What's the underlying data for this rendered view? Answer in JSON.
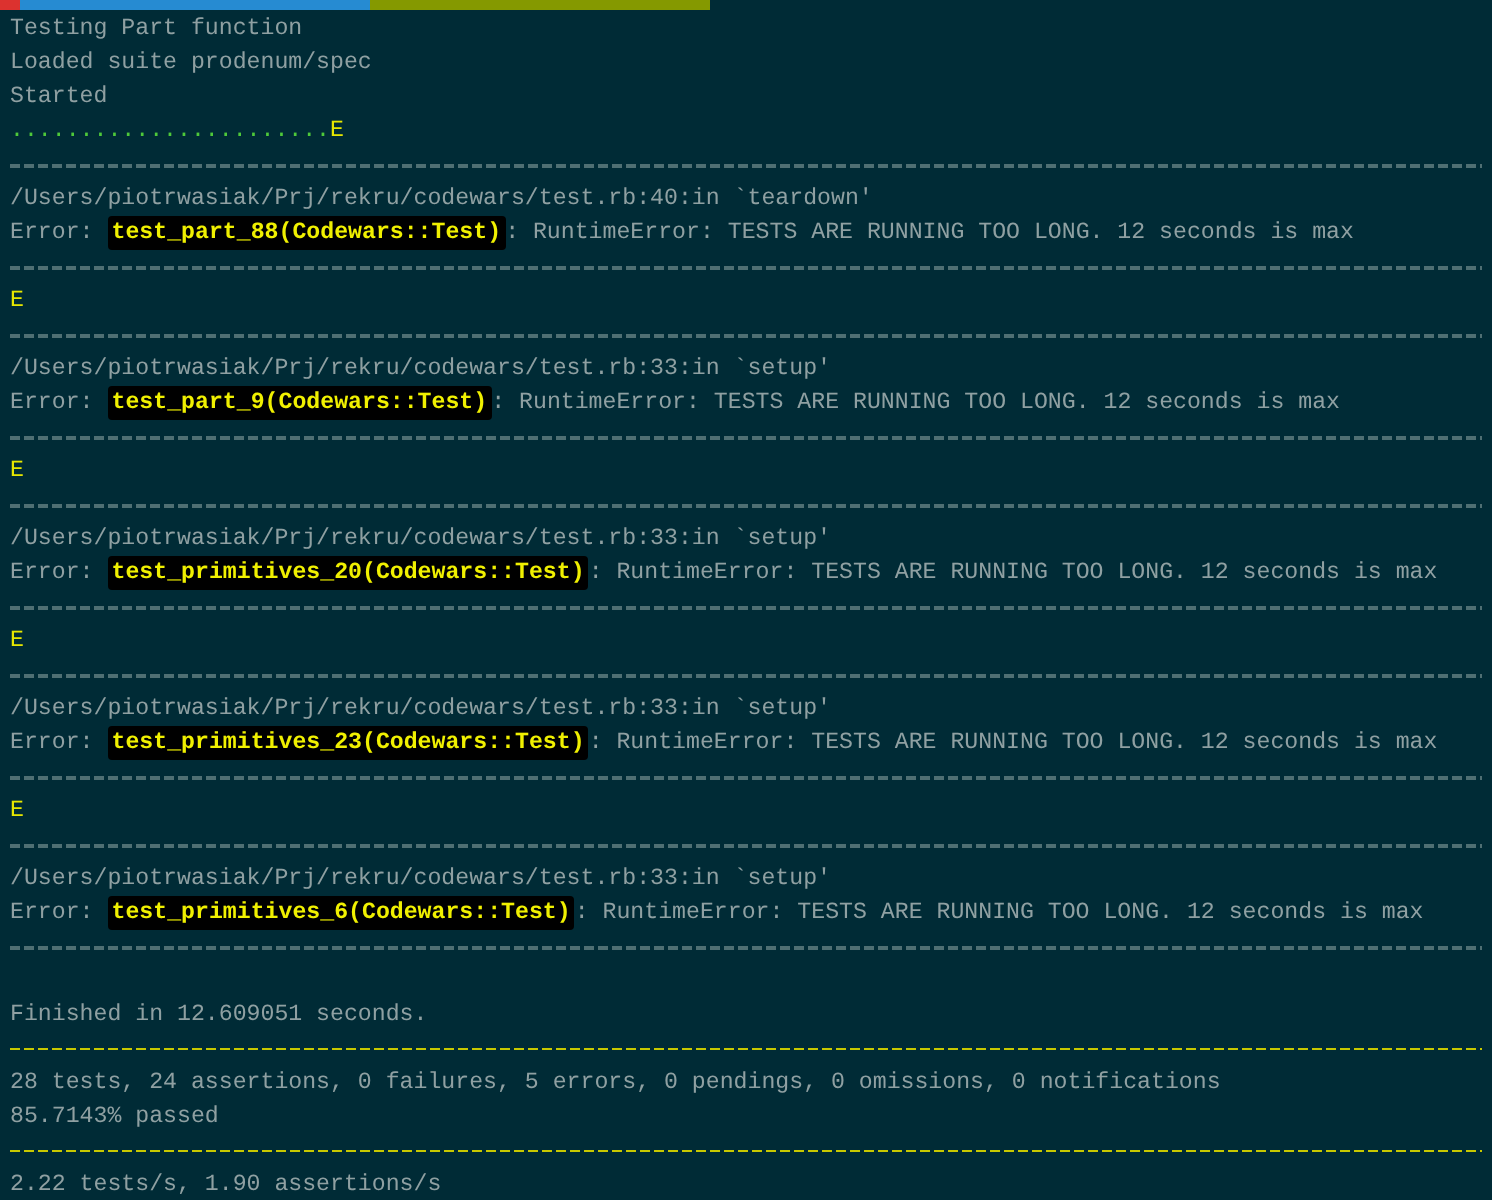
{
  "prompt_segments": [
    {
      "color": "#dc322f"
    },
    {
      "color": "#268bd2"
    },
    {
      "color": "#859900"
    }
  ],
  "lines": [
    {
      "kind": "plain",
      "text": "Testing Part function"
    },
    {
      "kind": "plain",
      "text": "Loaded suite prodenum/spec"
    },
    {
      "kind": "plain",
      "text": "Started"
    },
    {
      "kind": "progress",
      "passed": ".......................",
      "failed": "E"
    },
    {
      "kind": "double-rule"
    },
    {
      "kind": "plain",
      "text": "/Users/piotrwasiak/Prj/rekru/codewars/test.rb:40:in `teardown'"
    },
    {
      "kind": "error",
      "label": "Error:",
      "test": "test_part_88(Codewars::Test)",
      "message": ": RuntimeError: TESTS ARE RUNNING TOO LONG. 12 seconds is max"
    },
    {
      "kind": "double-rule"
    },
    {
      "kind": "marker",
      "text": "E"
    },
    {
      "kind": "double-rule"
    },
    {
      "kind": "plain",
      "text": "/Users/piotrwasiak/Prj/rekru/codewars/test.rb:33:in `setup'"
    },
    {
      "kind": "error",
      "label": "Error:",
      "test": "test_part_9(Codewars::Test)",
      "message": ": RuntimeError: TESTS ARE RUNNING TOO LONG. 12 seconds is max"
    },
    {
      "kind": "double-rule"
    },
    {
      "kind": "marker",
      "text": "E"
    },
    {
      "kind": "double-rule"
    },
    {
      "kind": "plain",
      "text": "/Users/piotrwasiak/Prj/rekru/codewars/test.rb:33:in `setup'"
    },
    {
      "kind": "error",
      "label": "Error:",
      "test": "test_primitives_20(Codewars::Test)",
      "message": ": RuntimeError: TESTS ARE RUNNING TOO LONG. 12 seconds is max"
    },
    {
      "kind": "double-rule"
    },
    {
      "kind": "marker",
      "text": "E"
    },
    {
      "kind": "double-rule"
    },
    {
      "kind": "plain",
      "text": "/Users/piotrwasiak/Prj/rekru/codewars/test.rb:33:in `setup'"
    },
    {
      "kind": "error",
      "label": "Error:",
      "test": "test_primitives_23(Codewars::Test)",
      "message": ": RuntimeError: TESTS ARE RUNNING TOO LONG. 12 seconds is max"
    },
    {
      "kind": "double-rule"
    },
    {
      "kind": "marker",
      "text": "E"
    },
    {
      "kind": "double-rule"
    },
    {
      "kind": "plain",
      "text": "/Users/piotrwasiak/Prj/rekru/codewars/test.rb:33:in `setup'"
    },
    {
      "kind": "error",
      "label": "Error:",
      "test": "test_primitives_6(Codewars::Test)",
      "message": ": RuntimeError: TESTS ARE RUNNING TOO LONG. 12 seconds is max"
    },
    {
      "kind": "double-rule"
    },
    {
      "kind": "blank"
    },
    {
      "kind": "plain",
      "text": "Finished in 12.609051 seconds."
    },
    {
      "kind": "dashed-rule"
    },
    {
      "kind": "plain",
      "text": "28 tests, 24 assertions, 0 failures, 5 errors, 0 pendings, 0 omissions, 0 notifications"
    },
    {
      "kind": "plain",
      "text": "85.7143% passed"
    },
    {
      "kind": "dashed-rule"
    },
    {
      "kind": "plain",
      "text": "2.22 tests/s, 1.90 assertions/s"
    }
  ]
}
